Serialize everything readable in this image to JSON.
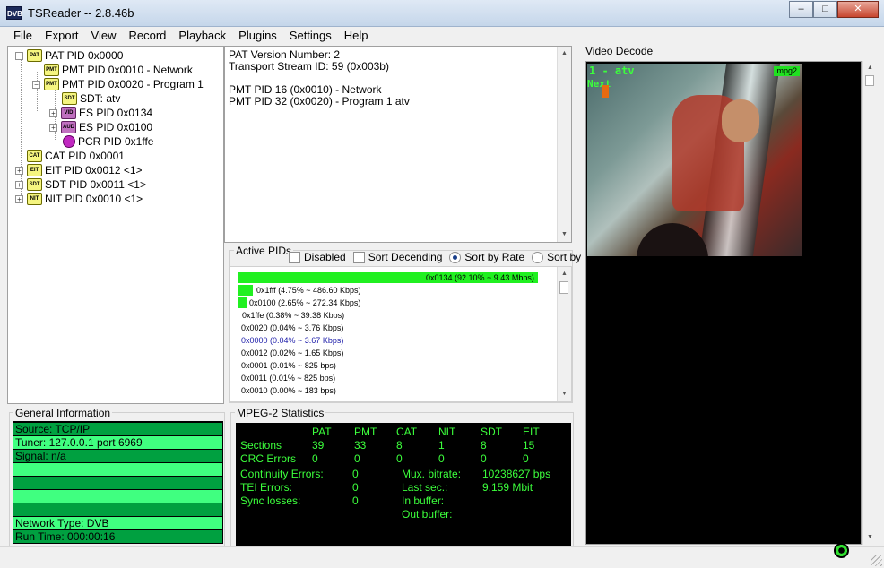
{
  "window": {
    "title": "TSReader -- 2.8.46b",
    "icon_text": "DVB"
  },
  "menu": [
    "File",
    "Export",
    "View",
    "Record",
    "Playback",
    "Plugins",
    "Settings",
    "Help"
  ],
  "tree": [
    {
      "label": "PAT PID 0x0000",
      "icon": "PAT",
      "expander": "−"
    },
    {
      "label": "PMT PID 0x0010 - Network",
      "icon": "PMT",
      "expander": ""
    },
    {
      "label": "PMT PID 0x0020 - Program 1",
      "icon": "PMT",
      "expander": "−"
    },
    {
      "label": "SDT: atv",
      "icon": "SDT",
      "expander": ""
    },
    {
      "label": "ES PID 0x0134",
      "icon": "VID",
      "expander": "+"
    },
    {
      "label": "ES PID 0x0100",
      "icon": "AUD",
      "expander": "+"
    },
    {
      "label": "PCR PID 0x1ffe",
      "icon": "",
      "expander": ""
    },
    {
      "label": "CAT PID 0x0001",
      "icon": "CAT",
      "expander": ""
    },
    {
      "label": "EIT PID 0x0012 <1>",
      "icon": "EIT",
      "expander": "+"
    },
    {
      "label": "SDT PID 0x0011 <1>",
      "icon": "SDT",
      "expander": "+"
    },
    {
      "label": "NIT PID 0x0010 <1>",
      "icon": "NIT",
      "expander": "+"
    }
  ],
  "info_lines": [
    "PAT Version Number: 2",
    "Transport Stream ID: 59 (0x003b)",
    "",
    "PMT PID 16 (0x0010) - Network",
    "PMT PID 32 (0x0020) - Program 1 atv"
  ],
  "active_pids": {
    "label": "Active PIDs",
    "options": {
      "disabled": "Disabled",
      "sort_descending": "Sort Decending",
      "sort_by_rate": "Sort by Rate",
      "sort_by_pid": "Sort by PID"
    },
    "rows": [
      {
        "text": "0x0134 (92.10% ~ 9.43 Mbps)",
        "share": 0.921
      },
      {
        "text": "0x1fff (4.75% ~ 486.60 Kbps)",
        "share": 0.0475
      },
      {
        "text": "0x0100 (2.65% ~ 272.34 Kbps)",
        "share": 0.0265
      },
      {
        "text": "0x1ffe (0.38% ~ 39.38 Kbps)",
        "share": 0.0038
      },
      {
        "text": "0x0020 (0.04% ~ 3.76 Kbps)",
        "share": 0.0004
      },
      {
        "text": "0x0000 (0.04% ~ 3.67 Kbps)",
        "share": 0.0004
      },
      {
        "text": "0x0012 (0.02% ~ 1.65 Kbps)",
        "share": 0.0002
      },
      {
        "text": "0x0001 (0.01% ~ 825 bps)",
        "share": 0.0001
      },
      {
        "text": "0x0011 (0.01% ~ 825 bps)",
        "share": 0.0001
      },
      {
        "text": "0x0010 (0.00% ~ 183 bps)",
        "share": 0.0
      }
    ]
  },
  "video": {
    "label": "Video Decode",
    "osd_title": "1 - atv",
    "osd_next": "Next",
    "codec": "mpg2"
  },
  "general": {
    "label": "General Information",
    "rows": [
      "Source: TCP/IP",
      "Tuner: 127.0.0.1 port 6969",
      "Signal: n/a",
      "",
      "",
      "",
      "",
      "Network Type: DVB",
      "Run Time: 000:00:16"
    ]
  },
  "stats": {
    "label": "MPEG-2 Statistics",
    "columns": [
      "PAT",
      "PMT",
      "CAT",
      "NIT",
      "SDT",
      "EIT"
    ],
    "sections_label": "Sections",
    "sections": [
      "39",
      "33",
      "8",
      "1",
      "8",
      "15"
    ],
    "crc_label": "CRC Errors",
    "crc": [
      "0",
      "0",
      "0",
      "0",
      "0",
      "0"
    ],
    "continuity_label": "Continuity Errors:",
    "continuity": "0",
    "tei_label": "TEI Errors:",
    "tei": "0",
    "sync_label": "Sync losses:",
    "sync": "0",
    "mux_label": "Mux. bitrate:",
    "mux": "10238627 bps",
    "last_label": "Last sec.:",
    "last": "9.159 Mbit",
    "inbuf_label": "In buffer:",
    "outbuf_label": "Out buffer:"
  }
}
